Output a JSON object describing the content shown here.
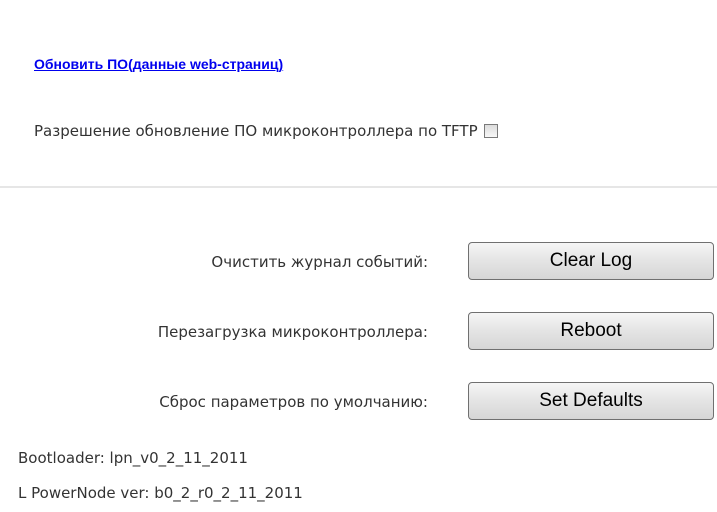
{
  "firmware": {
    "update_link_label": "Обновить ПО(данные web-страниц)",
    "tftp_label": "Разрешение обновление ПО микроконтроллера по TFTP",
    "tftp_enabled": false
  },
  "actions": {
    "clear_log": {
      "label": "Очистить журнал событий:",
      "button": "Clear Log"
    },
    "reboot": {
      "label": "Перезагрузка микроконтроллера:",
      "button": "Reboot"
    },
    "defaults": {
      "label": "Сброс параметров по умолчанию:",
      "button": "Set Defaults"
    }
  },
  "versions": {
    "bootloader": "Bootloader: lpn_v0_2_11_2011",
    "powernode": "L PowerNode ver: b0_2_r0_2_11_2011"
  }
}
